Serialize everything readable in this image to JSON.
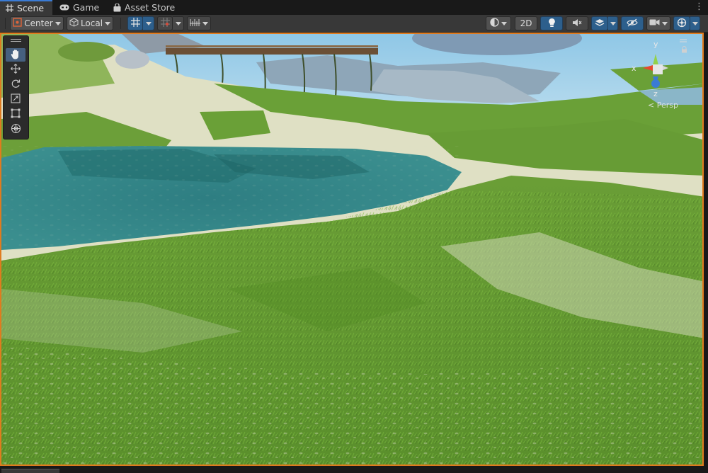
{
  "tabs": [
    {
      "label": "Scene",
      "icon": "scene-grid-icon",
      "active": true
    },
    {
      "label": "Game",
      "icon": "gamepad-icon",
      "active": false
    },
    {
      "label": "Asset Store",
      "icon": "shopping-bag-icon",
      "active": false
    }
  ],
  "toolbar": {
    "pivot_label": "Center",
    "space_label": "Local",
    "mode_2d_label": "2D"
  },
  "gizmo": {
    "projection_label": "< Persp",
    "axis_x": "x",
    "axis_y": "y",
    "axis_z": "z"
  },
  "colors": {
    "accent_blue": "#3a7bd5",
    "selection_orange": "#e07b1e",
    "axis_x": "#e8472e",
    "axis_y": "#93d14a",
    "axis_z": "#3a7bd5"
  }
}
